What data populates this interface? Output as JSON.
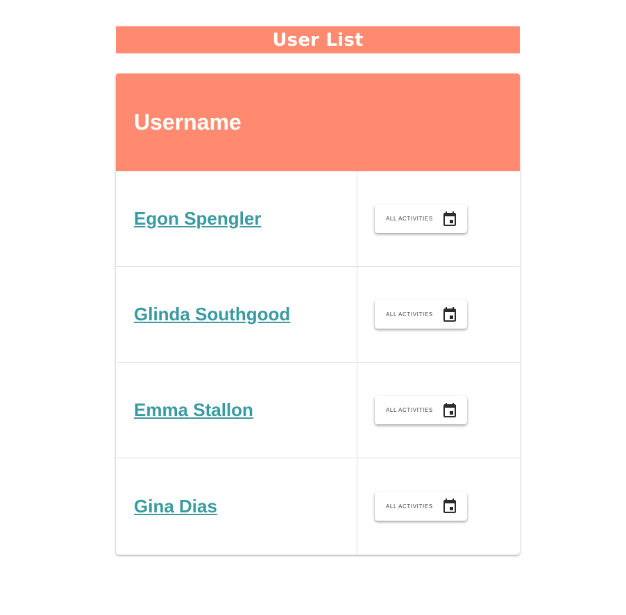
{
  "header": {
    "title": "User List"
  },
  "table": {
    "column_header": "Username",
    "rows": [
      {
        "username": "Egon Spengler",
        "action_label": "ALL ACTIVITIES",
        "action_icon": "calendar-icon"
      },
      {
        "username": "Glinda Southgood",
        "action_label": "ALL ACTIVITIES",
        "action_icon": "calendar-icon"
      },
      {
        "username": "Emma Stallon",
        "action_label": "ALL ACTIVITIES",
        "action_icon": "calendar-icon"
      },
      {
        "username": "Gina Dias",
        "action_label": "ALL ACTIVITIES",
        "action_icon": "calendar-icon"
      }
    ]
  },
  "colors": {
    "header_bg": "#ff8a70",
    "link": "#3a9aa0",
    "divider": "#e0e0e0"
  }
}
